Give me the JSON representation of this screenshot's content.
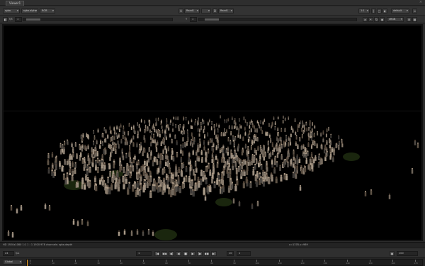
{
  "tab": {
    "label": "Viewer1",
    "close": "×"
  },
  "toolbar1": {
    "channels": "rgba",
    "layer": "rgba.alpha",
    "display": "RGB",
    "input_a": "Read1",
    "input_b": "Read1",
    "zoom": "1:1",
    "lut": "default",
    "icons": {
      "wipe": "|",
      "roi": "□",
      "settings": "≡"
    }
  },
  "toolbar2": {
    "gain_label": "f/8",
    "gain_value": "1",
    "gamma_label": "Y",
    "gamma_value": "1",
    "colorspace": "sRGB",
    "frame_label": "2D",
    "icons": {
      "clip": "⌀",
      "lock": "•",
      "refresh": "↻",
      "pause": "◉"
    }
  },
  "status": {
    "format": "HD 1920x1080 1:1   1 : 1   1920 978   channels: rgba.depth",
    "coords": "x=1378 y=989"
  },
  "transport": {
    "fps_label": "fps",
    "fps_value": "24",
    "frame": "1",
    "range_start": "1",
    "range_end": "100",
    "mode": "Global",
    "buttons": [
      "|◀",
      "◀◀",
      "◀|",
      "◀",
      "■",
      "▶",
      "|▶",
      "▶▶",
      "▶|"
    ],
    "step": "10"
  },
  "timeline": {
    "ticks": [
      "1",
      "10",
      "20",
      "30",
      "40",
      "50",
      "60",
      "70",
      "80",
      "90",
      "100",
      "110",
      "120",
      "130",
      "140",
      "150",
      "160",
      "170"
    ]
  }
}
